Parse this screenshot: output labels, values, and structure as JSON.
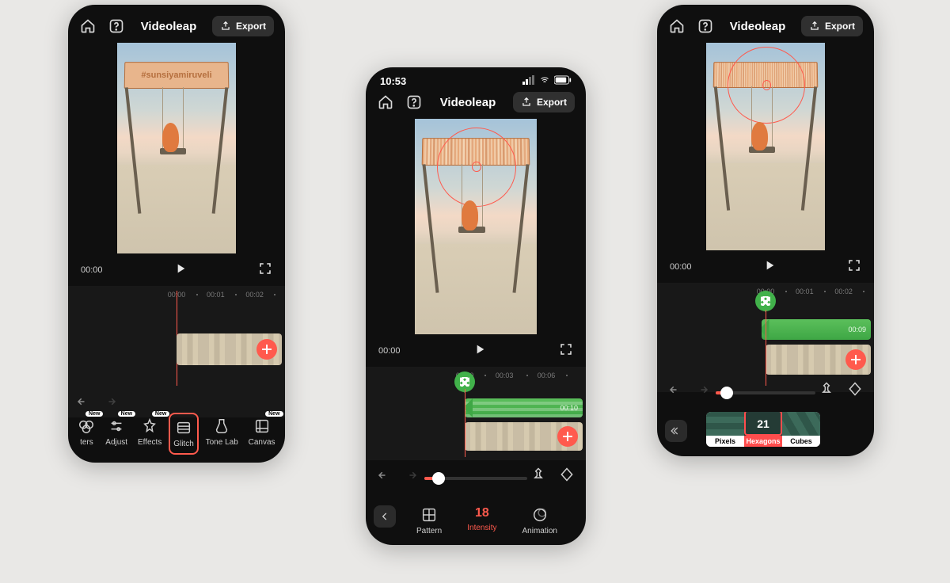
{
  "app_title": "Videoleap",
  "export_label": "Export",
  "status_time": "10:53",
  "screens": {
    "a": {
      "sign_text": "#sunsiyamiruveli",
      "time_current": "00:00",
      "ruler": [
        {
          "pos": 50,
          "label": "00:00"
        },
        {
          "pos": 68,
          "label": "00:01"
        },
        {
          "pos": 86,
          "label": "00:02"
        }
      ],
      "tools": [
        "ters",
        "Adjust",
        "Effects",
        "Glitch",
        "Tone Lab",
        "Canvas"
      ],
      "tool_new": [
        true,
        true,
        true,
        false,
        false,
        true
      ],
      "tool_selected": 3
    },
    "b": {
      "time_current": "00:00",
      "ruler": [
        {
          "pos": 45,
          "label": "00:00"
        },
        {
          "pos": 63,
          "label": "00:03"
        },
        {
          "pos": 82,
          "label": "00:06"
        }
      ],
      "effect_duration": "00:10",
      "slider_value": 18,
      "slider_pct": 14,
      "params": [
        "Pattern",
        "Intensity",
        "Animation"
      ],
      "param_selected": 1
    },
    "c": {
      "time_current": "00:00",
      "ruler": [
        {
          "pos": 50,
          "label": "00:00"
        },
        {
          "pos": 68,
          "label": "00:01"
        },
        {
          "pos": 86,
          "label": "00:02"
        }
      ],
      "effect_duration": "00:09",
      "slider_pct": 11,
      "patterns": [
        "Pixels",
        "Hexagons",
        "Cubes"
      ],
      "pattern_selected": 1,
      "pattern_value": "21"
    }
  }
}
